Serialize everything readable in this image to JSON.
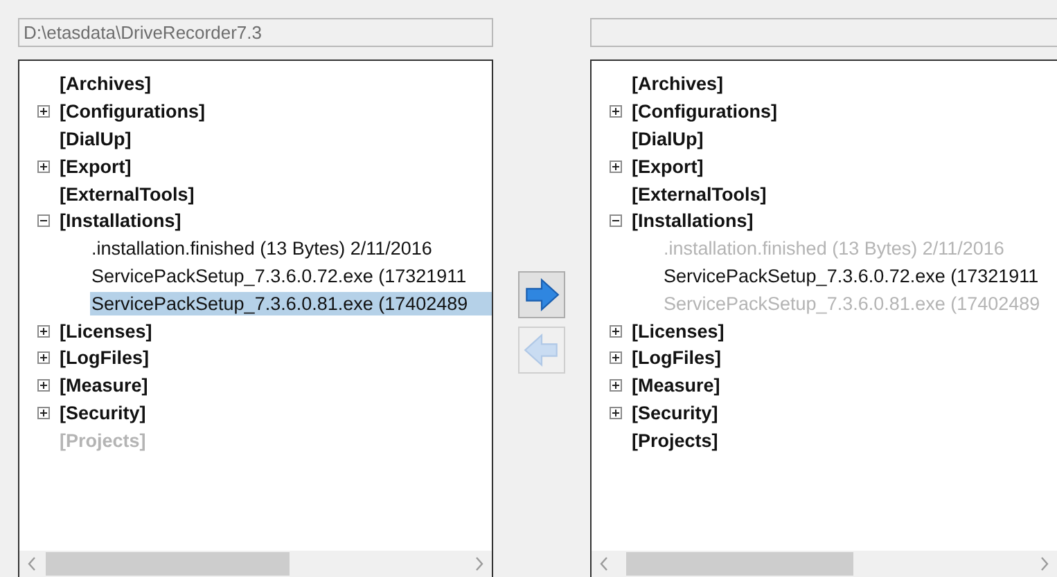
{
  "panes": [
    {
      "path_field": {
        "value": "D:\\etasdata\\DriveRecorder7.3",
        "disabled": true
      },
      "tree": [
        {
          "label": "[Archives]",
          "kind": "leaf",
          "disabled": false,
          "selected": false
        },
        {
          "label": "[Configurations]",
          "kind": "collapsed",
          "disabled": false,
          "selected": false
        },
        {
          "label": "[DialUp]",
          "kind": "leaf",
          "disabled": false,
          "selected": false
        },
        {
          "label": "[Export]",
          "kind": "collapsed",
          "disabled": false,
          "selected": false
        },
        {
          "label": "[ExternalTools]",
          "kind": "leaf",
          "disabled": false,
          "selected": false
        },
        {
          "label": "[Installations]",
          "kind": "expanded",
          "disabled": false,
          "selected": false,
          "children": [
            {
              "label": ".installation.finished (13 Bytes) 2/11/2016",
              "kind": "leaf",
              "disabled": false,
              "selected": false
            },
            {
              "label": "ServicePackSetup_7.3.6.0.72.exe (17321911",
              "kind": "leaf",
              "disabled": false,
              "selected": false
            },
            {
              "label": "ServicePackSetup_7.3.6.0.81.exe (17402489",
              "kind": "leaf",
              "disabled": false,
              "selected": true
            }
          ]
        },
        {
          "label": "[Licenses]",
          "kind": "collapsed",
          "disabled": false,
          "selected": false
        },
        {
          "label": "[LogFiles]",
          "kind": "collapsed",
          "disabled": false,
          "selected": false
        },
        {
          "label": "[Measure]",
          "kind": "collapsed",
          "disabled": false,
          "selected": false
        },
        {
          "label": "[Security]",
          "kind": "collapsed",
          "disabled": false,
          "selected": false
        },
        {
          "label": "[Projects]",
          "kind": "leaf",
          "disabled": true,
          "selected": false
        }
      ]
    },
    {
      "path_field": {
        "disabled": true
      },
      "tree": [
        {
          "label": "[Archives]",
          "kind": "leaf",
          "disabled": false,
          "selected": false
        },
        {
          "label": "[Configurations]",
          "kind": "collapsed",
          "disabled": false,
          "selected": false
        },
        {
          "label": "[DialUp]",
          "kind": "leaf",
          "disabled": false,
          "selected": false
        },
        {
          "label": "[Export]",
          "kind": "collapsed",
          "disabled": false,
          "selected": false
        },
        {
          "label": "[ExternalTools]",
          "kind": "leaf",
          "disabled": false,
          "selected": false
        },
        {
          "label": "[Installations]",
          "kind": "expanded",
          "disabled": false,
          "selected": false,
          "children": [
            {
              "label": ".installation.finished (13 Bytes) 2/11/2016",
              "kind": "leaf",
              "disabled": true,
              "selected": false
            },
            {
              "label": "ServicePackSetup_7.3.6.0.72.exe (17321911",
              "kind": "leaf",
              "disabled": false,
              "selected": false
            },
            {
              "label": "ServicePackSetup_7.3.6.0.81.exe (17402489",
              "kind": "leaf",
              "disabled": true,
              "selected": false
            }
          ]
        },
        {
          "label": "[Licenses]",
          "kind": "collapsed",
          "disabled": false,
          "selected": false
        },
        {
          "label": "[LogFiles]",
          "kind": "collapsed",
          "disabled": false,
          "selected": false
        },
        {
          "label": "[Measure]",
          "kind": "collapsed",
          "disabled": false,
          "selected": false
        },
        {
          "label": "[Security]",
          "kind": "collapsed",
          "disabled": false,
          "selected": false
        },
        {
          "label": "[Projects]",
          "kind": "leaf",
          "disabled": false,
          "selected": false
        }
      ]
    }
  ],
  "transfer_buttons": [
    {
      "kind": "right",
      "disabled": false
    },
    {
      "kind": "left",
      "disabled": true
    }
  ]
}
